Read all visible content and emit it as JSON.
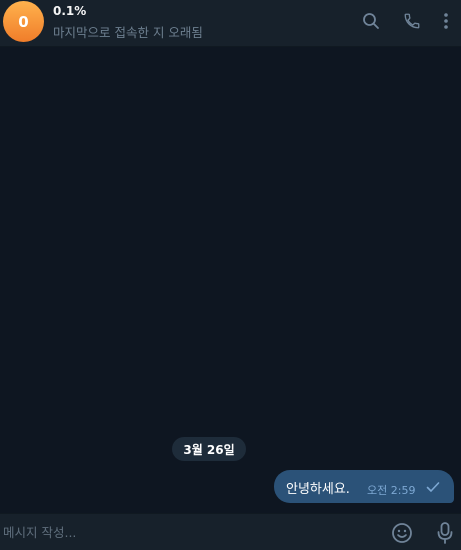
{
  "header": {
    "avatar_initial": "0",
    "chat_name": "0.1%",
    "status": "마지막으로 접속한 지 오래됨",
    "icons": [
      "search-icon",
      "phone-icon",
      "more-vertical-icon"
    ]
  },
  "messages": {
    "date_separator": "3월 26일",
    "items": [
      {
        "text": "안녕하세요.",
        "time": "오전 2:59",
        "outgoing": true,
        "status_icon": "check-icon"
      }
    ]
  },
  "composer": {
    "placeholder": "메시지 작성...",
    "value": "",
    "icons": [
      "emoji-icon",
      "microphone-icon"
    ]
  },
  "colors": {
    "background": "#0e1621",
    "panel": "#17212b",
    "bubble_out": "#2b5278",
    "icon": "#708499",
    "avatar_gradient": [
      "#ffb24d",
      "#f07d2a"
    ]
  }
}
